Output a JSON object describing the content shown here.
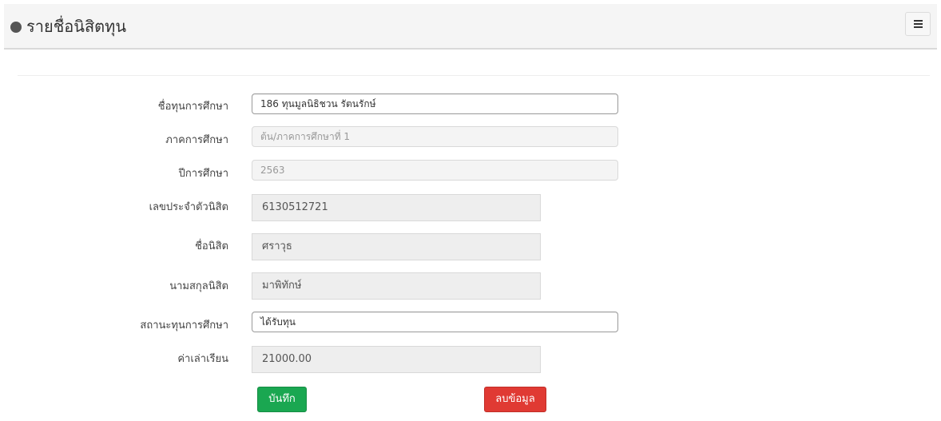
{
  "header": {
    "title": "รายชื่อนิสิตทุน",
    "bullet_icon": "circle-bullet-icon",
    "menu_icon": "list-menu-icon"
  },
  "form": {
    "scholarship": {
      "label": "ชื่อทุนการศึกษา",
      "value": "186 ทุนมูลนิธิชวน รัตนรักษ์"
    },
    "semester": {
      "label": "ภาคการศึกษา",
      "value": "ต้น/ภาคการศึกษาที่ 1"
    },
    "year": {
      "label": "ปีการศึกษา",
      "value": "2563"
    },
    "student_id": {
      "label": "เลขประจำตัวนิสิต",
      "value": "6130512721"
    },
    "first_name": {
      "label": "ชื่อนิสิต",
      "value": "ศราวุธ"
    },
    "last_name": {
      "label": "นามสกุลนิสิต",
      "value": "มาพิทักษ์"
    },
    "status": {
      "label": "สถานะทุนการศึกษา",
      "value": "ได้รับทุน"
    },
    "tuition": {
      "label": "ค่าเล่าเรียน",
      "value": "21000.00"
    }
  },
  "buttons": {
    "save": "บันทึก",
    "delete": "ลบข้อมูล"
  },
  "colors": {
    "save": "#1aa751",
    "delete": "#e03a33",
    "header_bg": "#f5f5f5"
  }
}
